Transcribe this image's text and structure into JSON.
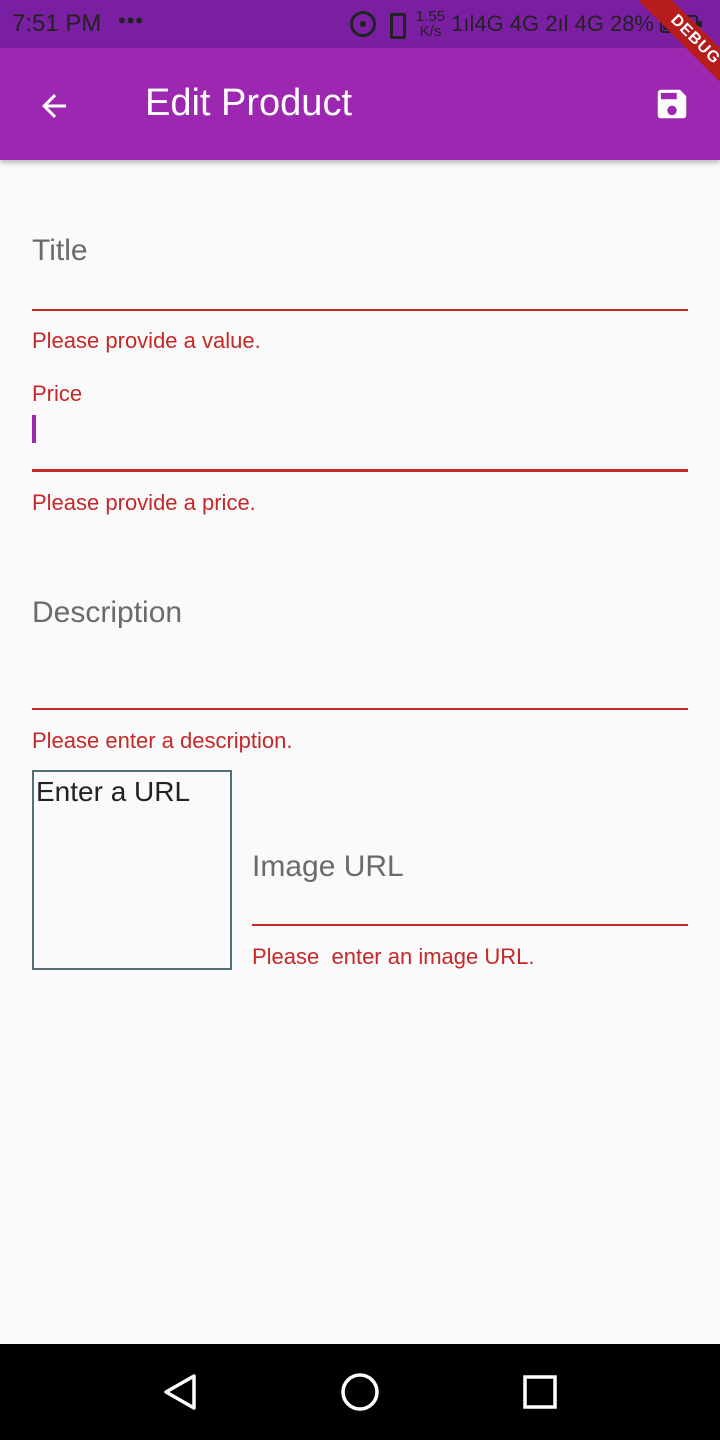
{
  "status_bar": {
    "time": "7:51 PM",
    "dots": "•••",
    "speed_value": "1.55",
    "speed_unit": "K/s",
    "network": "1ıl4G 4G 2ıl 4G",
    "battery_percent": "28%",
    "battery_level": 0.28
  },
  "debug_banner": "DEBUG",
  "app_bar": {
    "title": "Edit Product",
    "back_icon": "arrow-back-icon",
    "save_icon": "save-icon",
    "background": "#9c27b0"
  },
  "form": {
    "title": {
      "label": "Title",
      "error": "Please provide a value."
    },
    "price": {
      "label": "Price",
      "error": "Please provide a price."
    },
    "description": {
      "label": "Description",
      "error": "Please enter a description."
    },
    "image_preview": {
      "text": "Enter a URL"
    },
    "image_url": {
      "label": "Image URL",
      "error": "Please  enter an image URL."
    }
  },
  "colors": {
    "accent": "#9c27b0",
    "error": "#c62828",
    "status_bar": "#7b1fa2"
  },
  "nav_bar": {
    "back_icon": "nav-back-icon",
    "home_icon": "nav-home-icon",
    "recents_icon": "nav-recents-icon"
  }
}
